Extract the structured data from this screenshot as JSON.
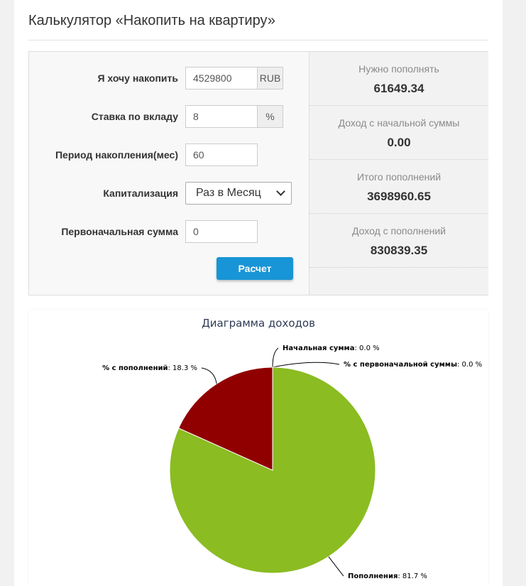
{
  "page": {
    "title": "Калькулятор «Накопить на квартиру»"
  },
  "form": {
    "target_label": "Я хочу накопить",
    "target_value": "4529800",
    "target_currency": "RUB",
    "rate_label": "Ставка по вкладу",
    "rate_value": "8",
    "rate_unit": "%",
    "period_label": "Период накопления(мес)",
    "period_value": "60",
    "capitalization_label": "Капитализация",
    "capitalization_value": "Раз в Месяц",
    "initial_label": "Первоначальная сумма",
    "initial_value": "0",
    "submit_label": "Расчет"
  },
  "results": [
    {
      "label": "Нужно пополнять",
      "value": "61649.34"
    },
    {
      "label": "Доход с начальной суммы",
      "value": "0.00"
    },
    {
      "label": "Итого пополнений",
      "value": "3698960.65"
    },
    {
      "label": "Доход с пополнений",
      "value": "830839.35"
    }
  ],
  "colors": {
    "accent_button": "#1895d6",
    "slice_deposits": "#8bbc21",
    "slice_interest_deposits": "#910000"
  },
  "chart_data": {
    "type": "pie",
    "title": "Диаграмма доходов",
    "slices": [
      {
        "name": "Начальная сумма",
        "value": 0.0,
        "label": "Начальная сумма",
        "suffix": ": 0.0 %",
        "color": "#2f7ed8"
      },
      {
        "name": "% с первоначальной суммы",
        "value": 0.0,
        "label": "% с первоначальной суммы",
        "suffix": ": 0.0 %",
        "color": "#0d233a"
      },
      {
        "name": "Пополнения",
        "value": 81.7,
        "label": "Пополнения",
        "suffix": ": 81.7 %",
        "color": "#8bbc21"
      },
      {
        "name": "% с пополнений",
        "value": 18.3,
        "label": "% с пополнений",
        "suffix": ": 18.3 %",
        "color": "#910000"
      }
    ]
  }
}
